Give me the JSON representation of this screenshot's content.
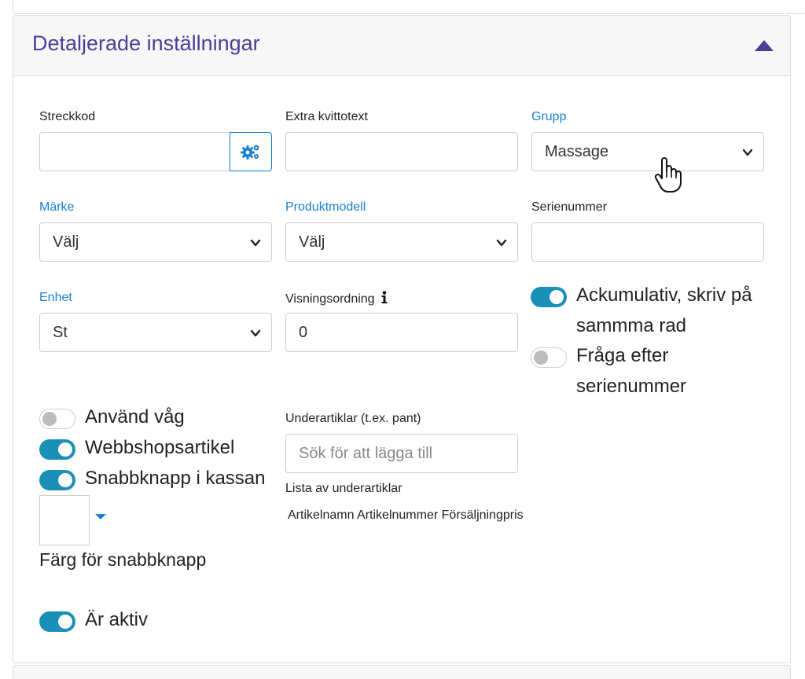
{
  "panel": {
    "title": "Detaljerade inställningar"
  },
  "fields": {
    "streckkod": {
      "label": "Streckkod",
      "value": ""
    },
    "extra_kvittotext": {
      "label": "Extra kvittotext",
      "value": ""
    },
    "grupp": {
      "label": "Grupp",
      "selected": "Massage"
    },
    "marke": {
      "label": "Märke",
      "selected": "Välj"
    },
    "produktmodell": {
      "label": "Produktmodell",
      "selected": "Välj"
    },
    "serienummer": {
      "label": "Serienummer",
      "value": ""
    },
    "enhet": {
      "label": "Enhet",
      "selected": "St"
    },
    "visningsordning": {
      "label": "Visningsordning",
      "value": "0"
    },
    "underartiklar": {
      "label": "Underartiklar (t.ex. pant)",
      "placeholder": "Sök för att lägga till"
    }
  },
  "toggles": {
    "ackumulativ": {
      "line1": "Ackumulativ, skriv på",
      "line2": "sammma rad",
      "on": true
    },
    "fraga_serienummer": {
      "line1": "Fråga efter",
      "line2": "serienummer",
      "on": false
    },
    "anvand_vag": {
      "label": "Använd våg",
      "on": false
    },
    "webbshop": {
      "label": "Webbshopsartikel",
      "on": true
    },
    "snabbknapp": {
      "label": "Snabbknapp i kassan",
      "on": true
    },
    "ar_aktiv": {
      "label": "Är aktiv",
      "on": true
    }
  },
  "snabbknapp_color": {
    "label": "Färg för snabbknapp"
  },
  "subitems": {
    "list_label": "Lista av underartiklar",
    "columns": [
      "Artikelnamn",
      "Artikelnummer",
      "Försäljningpris"
    ]
  },
  "colors": {
    "title": "#4a3f96",
    "accent_blue": "#1a7fd1",
    "toggle_on": "#1a8fb8"
  }
}
